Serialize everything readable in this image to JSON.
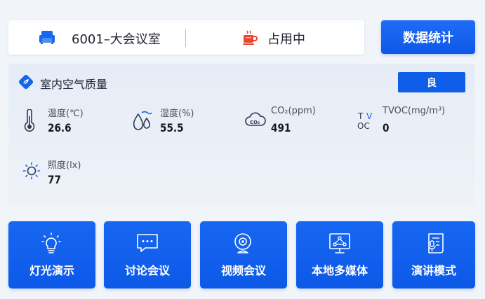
{
  "header": {
    "room_name": "6001–大会议室",
    "status": "占用中"
  },
  "actions": {
    "stats_label": "数据统计"
  },
  "air_quality": {
    "title": "室内空气质量",
    "grade": "良",
    "metrics": [
      {
        "label": "温度(℃)",
        "value": "26.6",
        "icon": "thermometer-icon"
      },
      {
        "label": "湿度(%)",
        "value": "55.5",
        "icon": "humidity-icon"
      },
      {
        "label": "CO₂(ppm)",
        "value": "491",
        "icon": "co2-icon"
      },
      {
        "label": "TVOC(mg/m³)",
        "value": "0",
        "icon": "tvoc-icon"
      },
      {
        "label": "照度(lx)",
        "value": "77",
        "icon": "sun-icon"
      }
    ]
  },
  "modes": [
    {
      "label": "灯光演示",
      "icon": "lightbulb-icon"
    },
    {
      "label": "讨论会议",
      "icon": "chat-icon"
    },
    {
      "label": "视频会议",
      "icon": "webcam-icon"
    },
    {
      "label": "本地多媒体",
      "icon": "multimedia-icon"
    },
    {
      "label": "演讲模式",
      "icon": "speech-icon"
    }
  ],
  "colors": {
    "accent": "#0f5ee9",
    "background": "#f1f4f9",
    "panel": "#e8edf6",
    "status_icon": "#e6462e"
  }
}
